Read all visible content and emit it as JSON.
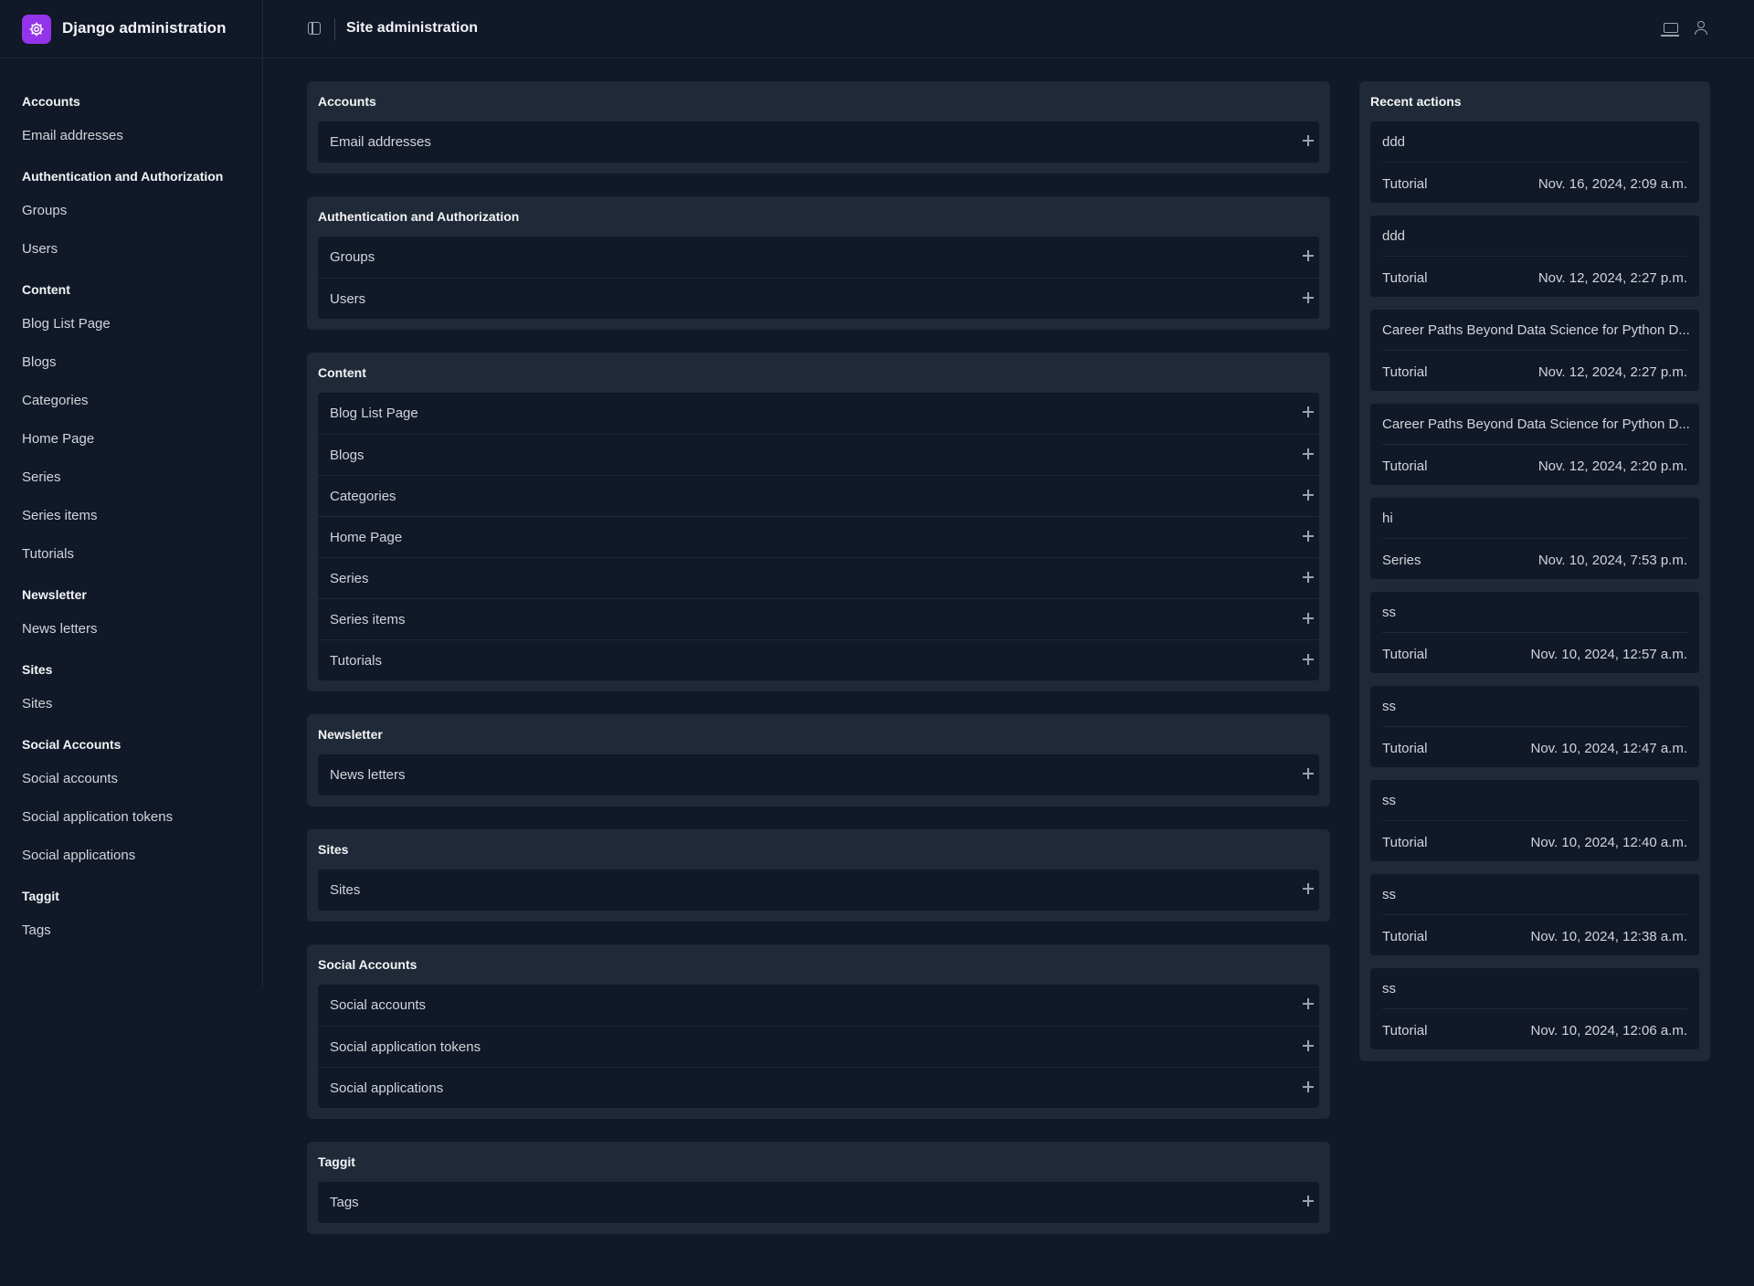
{
  "header": {
    "brand": "Django administration",
    "title": "Site administration",
    "accent_color": "#9333ea",
    "icons": [
      "gear-icon",
      "sidebar-toggle-icon",
      "monitor-icon",
      "user-icon"
    ]
  },
  "sidebar": {
    "groups": [
      {
        "title": "Accounts",
        "items": [
          "Email addresses"
        ]
      },
      {
        "title": "Authentication and Authorization",
        "items": [
          "Groups",
          "Users"
        ]
      },
      {
        "title": "Content",
        "items": [
          "Blog List Page",
          "Blogs",
          "Categories",
          "Home Page",
          "Series",
          "Series items",
          "Tutorials"
        ]
      },
      {
        "title": "Newsletter",
        "items": [
          "News letters"
        ]
      },
      {
        "title": "Sites",
        "items": [
          "Sites"
        ]
      },
      {
        "title": "Social Accounts",
        "items": [
          "Social accounts",
          "Social application tokens",
          "Social applications"
        ]
      },
      {
        "title": "Taggit",
        "items": [
          "Tags"
        ]
      }
    ]
  },
  "modules": [
    {
      "title": "Accounts",
      "items": [
        "Email addresses"
      ]
    },
    {
      "title": "Authentication and Authorization",
      "items": [
        "Groups",
        "Users"
      ]
    },
    {
      "title": "Content",
      "items": [
        "Blog List Page",
        "Blogs",
        "Categories",
        "Home Page",
        "Series",
        "Series items",
        "Tutorials"
      ]
    },
    {
      "title": "Newsletter",
      "items": [
        "News letters"
      ]
    },
    {
      "title": "Sites",
      "items": [
        "Sites"
      ]
    },
    {
      "title": "Social Accounts",
      "items": [
        "Social accounts",
        "Social application tokens",
        "Social applications"
      ]
    },
    {
      "title": "Taggit",
      "items": [
        "Tags"
      ]
    }
  ],
  "recent": {
    "title": "Recent actions",
    "items": [
      {
        "name": "ddd",
        "type": "Tutorial",
        "date": "Nov. 16, 2024, 2:09 a.m."
      },
      {
        "name": "ddd",
        "type": "Tutorial",
        "date": "Nov. 12, 2024, 2:27 p.m."
      },
      {
        "name": "Career Paths Beyond Data Science for Python D...",
        "type": "Tutorial",
        "date": "Nov. 12, 2024, 2:27 p.m."
      },
      {
        "name": "Career Paths Beyond Data Science for Python D...",
        "type": "Tutorial",
        "date": "Nov. 12, 2024, 2:20 p.m."
      },
      {
        "name": "hi",
        "type": "Series",
        "date": "Nov. 10, 2024, 7:53 p.m."
      },
      {
        "name": "ss",
        "type": "Tutorial",
        "date": "Nov. 10, 2024, 12:57 a.m."
      },
      {
        "name": "ss",
        "type": "Tutorial",
        "date": "Nov. 10, 2024, 12:47 a.m."
      },
      {
        "name": "ss",
        "type": "Tutorial",
        "date": "Nov. 10, 2024, 12:40 a.m."
      },
      {
        "name": "ss",
        "type": "Tutorial",
        "date": "Nov. 10, 2024, 12:38 a.m."
      },
      {
        "name": "ss",
        "type": "Tutorial",
        "date": "Nov. 10, 2024, 12:06 a.m."
      }
    ]
  }
}
